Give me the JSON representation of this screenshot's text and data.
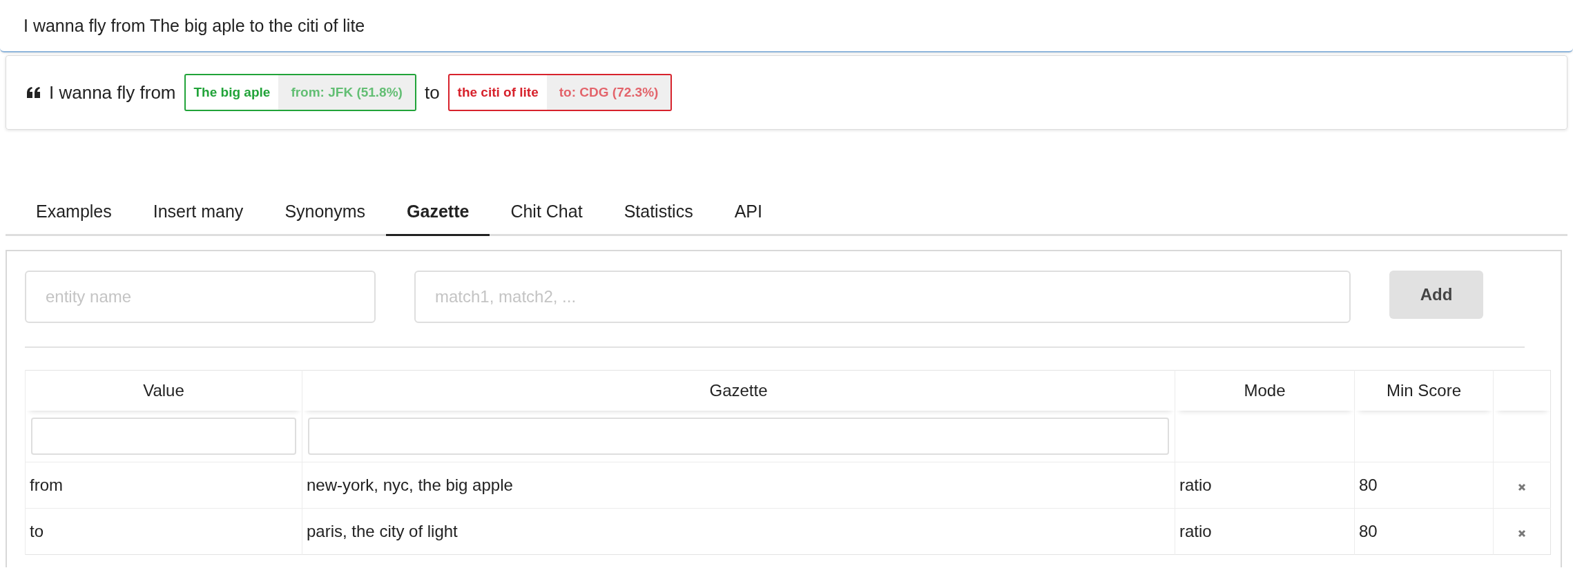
{
  "query": {
    "value": "I wanna fly from The big aple to the citi of lite"
  },
  "parse": {
    "parts": [
      {
        "kind": "text",
        "text": "I wanna fly from"
      },
      {
        "kind": "entity",
        "text": "The big aple",
        "label": "from: JFK (51.8%)",
        "color": "#21a339"
      },
      {
        "kind": "text",
        "text": "to"
      },
      {
        "kind": "entity",
        "text": "the citi of lite",
        "label": "to: CDG (72.3%)",
        "color": "#d7222c"
      }
    ]
  },
  "tabs": [
    {
      "label": "Examples",
      "selected": false
    },
    {
      "label": "Insert many",
      "selected": false
    },
    {
      "label": "Synonyms",
      "selected": false
    },
    {
      "label": "Gazette",
      "selected": true
    },
    {
      "label": "Chit Chat",
      "selected": false
    },
    {
      "label": "Statistics",
      "selected": false
    },
    {
      "label": "API",
      "selected": false
    }
  ],
  "form": {
    "entity_placeholder": "entity name",
    "matches_placeholder": "match1, match2, ...",
    "button": "Add"
  },
  "table": {
    "columns": [
      "Value",
      "Gazette",
      "Mode",
      "Min Score"
    ],
    "rows": [
      {
        "value": "from",
        "gazette": "new-york, nyc, the big apple",
        "mode": "ratio",
        "min_score": "80"
      },
      {
        "value": "to",
        "gazette": "paris, the city of light",
        "mode": "ratio",
        "min_score": "80"
      }
    ]
  }
}
